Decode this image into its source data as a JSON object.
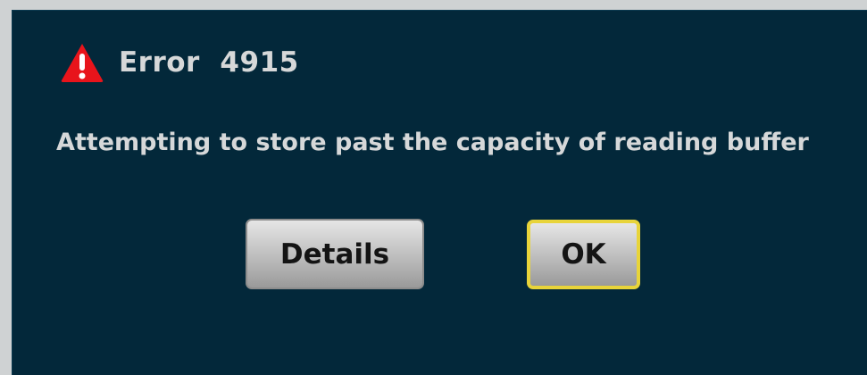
{
  "dialog": {
    "icon": "warning-triangle-icon",
    "title": "Error  4915",
    "message": "Attempting to store past the capacity of reading buffer",
    "buttons": {
      "details_label": "Details",
      "ok_label": "OK"
    },
    "colors": {
      "background": "#03283a",
      "text": "#d6d8d9",
      "icon_red": "#e8141b",
      "ok_focus_border": "#e8d43a"
    }
  }
}
